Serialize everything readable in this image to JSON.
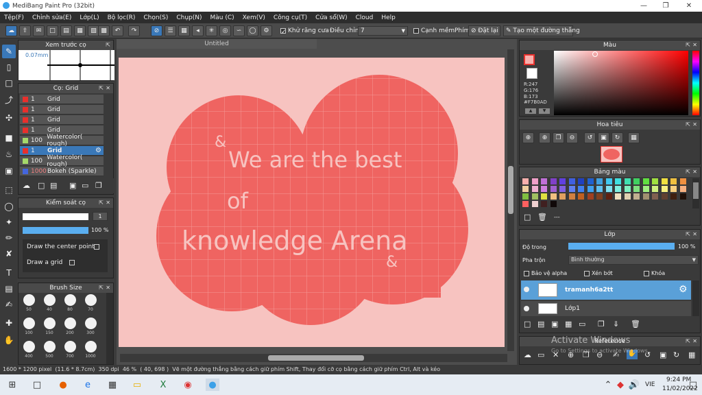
{
  "window": {
    "title": "MediBang Paint Pro (32bit)"
  },
  "menu": [
    "Tệp(F)",
    "Chỉnh sửa(E)",
    "Lớp(L)",
    "Bộ lọc(R)",
    "Chọn(S)",
    "Chụp(N)",
    "Màu (C)",
    "Xem(V)",
    "Công cụ(T)",
    "Cửa sổ(W)",
    "Cloud",
    "Help"
  ],
  "toolbar": {
    "antialias_label": "Khử răng cưa",
    "adjust_label": "Điều chỉnh",
    "adjust_value": "7",
    "edge_label": "Cạnh mềm",
    "key_label": "Phím",
    "reset_label": "Đặt lại",
    "straight_label": "Tạo một đường thẳng"
  },
  "preview_panel": {
    "title": "Xem trước cọ",
    "size": "0.07mm"
  },
  "brush_panel": {
    "title": "Cọ: Grid",
    "items": [
      {
        "size": "1",
        "name": "Grid",
        "color": "#e8302c"
      },
      {
        "size": "1",
        "name": "Grid",
        "color": "#e8302c"
      },
      {
        "size": "1",
        "name": "Grid",
        "color": "#e8302c"
      },
      {
        "size": "1",
        "name": "Grid",
        "color": "#e8302c"
      },
      {
        "size": "100",
        "name": "Watercolor( rough)",
        "color": "#a6d96a"
      },
      {
        "size": "1",
        "name": "Grid",
        "color": "#e8302c"
      },
      {
        "size": "100",
        "name": "Watercolor( rough)",
        "color": "#a6d96a"
      },
      {
        "size": "1000",
        "name": "Bokeh (Sparkle)",
        "color": "#4466dd"
      }
    ]
  },
  "control_panel": {
    "title": "Kiểm soát cọ",
    "size_value": "1",
    "opacity_value": "100 %",
    "center_point_label": "Draw the center point",
    "grid_label": "Draw a grid"
  },
  "brush_size_panel": {
    "title": "Brush Size",
    "sizes": [
      "50",
      "40",
      "80",
      "70",
      "100",
      "150",
      "200",
      "300",
      "400",
      "500",
      "700",
      "1000"
    ]
  },
  "canvas": {
    "tab": "Untitled",
    "line1": "We are the best",
    "line2": "of",
    "line3": "knowledge Arena",
    "bg_color": "#f7c3c0",
    "cloud_color": "#ef6461"
  },
  "color_panel": {
    "title": "Màu",
    "r": "R:247",
    "g": "G:176",
    "b": "B:173",
    "hex": "#F7B0AD"
  },
  "navigator_panel": {
    "title": "Hoa tiêu"
  },
  "palette_panel": {
    "title": "Bảng màu",
    "footer": "---",
    "colors": [
      "#f7b0ad",
      "#f0a0c8",
      "#c070d8",
      "#8040c8",
      "#6040e0",
      "#4060e0",
      "#2040c0",
      "#2060d0",
      "#40a0e0",
      "#40c8f0",
      "#40e0e0",
      "#40e0b0",
      "#40d060",
      "#60e040",
      "#a0e040",
      "#f0e040",
      "#f0c040",
      "#f09040",
      "#f0d0a0",
      "#f0b0d0",
      "#d080e0",
      "#a060d0",
      "#8060e0",
      "#6080f0",
      "#4080f0",
      "#40a0f0",
      "#60c0f0",
      "#80e0f0",
      "#80f0e0",
      "#80f0c0",
      "#80e080",
      "#a0f080",
      "#d0f080",
      "#f8f080",
      "#f8d080",
      "#f8b080",
      "#80c040",
      "#a0c060",
      "#e0e040",
      "#f0c080",
      "#e0a060",
      "#d08040",
      "#c06020",
      "#a04020",
      "#804020",
      "#602010",
      "#f0e0c0",
      "#e0d0b0",
      "#c0b090",
      "#a09070",
      "#806050",
      "#604030",
      "#402010",
      "#201008",
      "#ff6060",
      "#f0d0d0",
      "#402020",
      "#100808"
    ]
  },
  "layer_panel": {
    "title": "Lớp",
    "opacity_label": "Độ trong",
    "opacity_value": "100 %",
    "blend_label": "Pha trộn",
    "blend_value": "Bình thường",
    "protect_label": "Bảo vệ alpha",
    "clip_label": "Xén bớt",
    "lock_label": "Khóa",
    "layers": [
      {
        "name": "tramanh6a2tt"
      },
      {
        "name": "Lớp1"
      }
    ]
  },
  "reference_panel": {
    "title": "Reference"
  },
  "watermark": {
    "line1": "Activate Windows",
    "line2": "Go to Settings to activate Windows."
  },
  "status": {
    "size": "1600 * 1200 pixel",
    "dims": "(11.6 * 8.7cm)",
    "dpi": "350 dpi",
    "zoom": "46 %",
    "coords": "( 40, 698 )",
    "hint": "Vẽ một đường thẳng bằng cách giữ phím Shift, Thay đổi cỡ cọ bằng cách giữ phím Ctrl, Alt và kéo"
  },
  "taskbar": {
    "lang": "VIE",
    "time": "9:24 PM",
    "date": "11/02/2022"
  }
}
